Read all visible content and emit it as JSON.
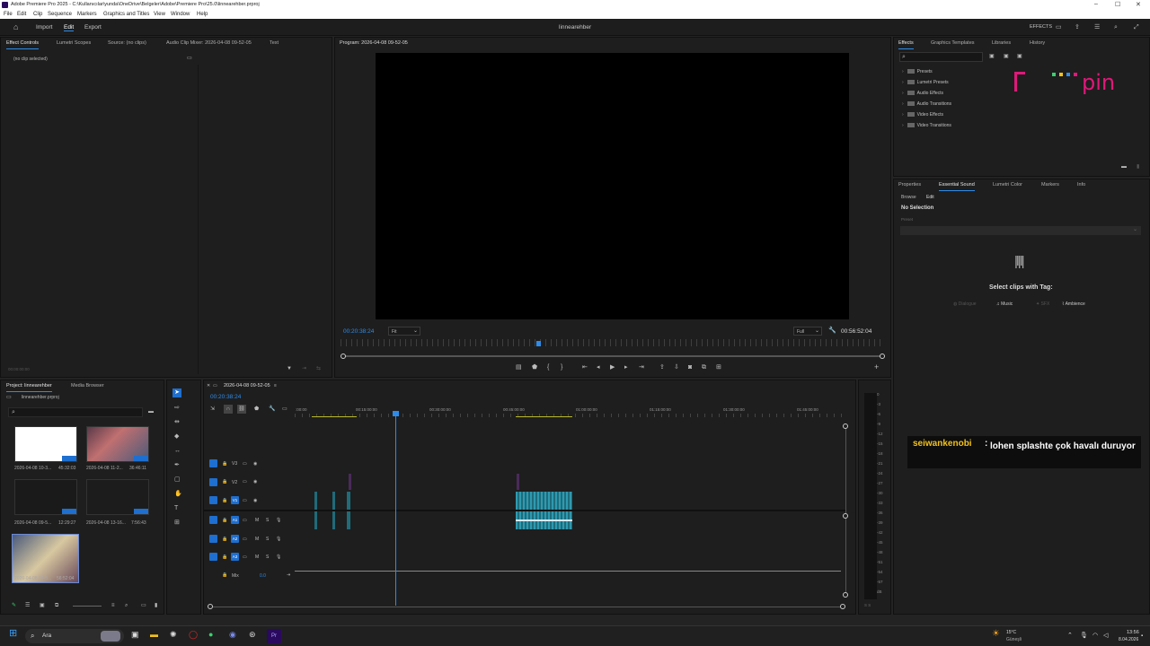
{
  "window": {
    "title": "Adobe Premiere Pro 2025 - C:\\Kullanıcılar\\yunda\\OneDrive\\Belgeler\\Adobe\\Premiere Pro\\25.0\\linnearehber.prproj"
  },
  "menu": [
    "File",
    "Edit",
    "Clip",
    "Sequence",
    "Markers",
    "Graphics and Titles",
    "View",
    "Window",
    "Help"
  ],
  "header": {
    "nav": [
      "Import",
      "Edit",
      "Export"
    ],
    "project_name": "linnearehber",
    "effects_label": "EFFECTS"
  },
  "source_panel": {
    "tabs": [
      "Effect Controls",
      "Lumetri Scopes",
      "Source: (no clips)",
      "Audio Clip Mixer: 2026-04-08 09-52-05",
      "Text"
    ],
    "no_clip": "(no clip selected)",
    "timecode": "00:00:00:00"
  },
  "program": {
    "title": "Program: 2026-04-08 09-52-05",
    "timecode_left": "00:20:38:24",
    "fit": "Fit",
    "quality": "Full",
    "timecode_right": "00:56:52:04",
    "playhead_fraction": 0.363
  },
  "effects_panel": {
    "tabs": [
      "Effects",
      "Graphics Templates",
      "Libraries",
      "History"
    ],
    "items": [
      "Presets",
      "Lumetri Presets",
      "Audio Effects",
      "Audio Transitions",
      "Video Effects",
      "Video Transitions"
    ],
    "logo_text": "pin"
  },
  "essential_sound": {
    "tabs": [
      "Properties",
      "Essential Sound",
      "Lumetri Color",
      "Markers",
      "Info"
    ],
    "subtabs": [
      "Browse",
      "Edit"
    ],
    "no_selection": "No Selection",
    "preset_label": "Preset",
    "select_text": "Select clips with Tag:",
    "tags": [
      "Dialogue",
      "Music",
      "SFX",
      "Ambience"
    ]
  },
  "chat": {
    "user": "seiwankenobi",
    "message": "lohen splashte çok havalı duruyor"
  },
  "project_panel": {
    "tabs": [
      "Project: linnearehber",
      "Media Browser"
    ],
    "file": "linnearehber.prproj",
    "items": [
      {
        "name": "2026-04-08 10-3...",
        "duration": "45:32:03"
      },
      {
        "name": "2026-04-08 11-2...",
        "duration": "36:46:11"
      },
      {
        "name": "2026-04-08 09-5...",
        "duration": "12:29:27"
      },
      {
        "name": "2026-04-08 13-16...",
        "duration": "7:56:43"
      },
      {
        "name": "2026-04-08 09-5...",
        "duration": "56:52:04"
      }
    ]
  },
  "timeline": {
    "sequence": "2026-04-08 09-52-05",
    "timecode": "00:20:38:24",
    "ruler": [
      ":00:00",
      "00:15:00:00",
      "00:30:00:00",
      "00:45:00:00",
      "01:00:00:00",
      "01:15:00:00",
      "01:30:00:00",
      "01:45:00:00"
    ],
    "video_tracks": [
      "V3",
      "V2",
      "V1"
    ],
    "audio_tracks": [
      "A1",
      "A2",
      "A3"
    ],
    "mix_label": "Mix",
    "mix_value": "0.0"
  },
  "meter": {
    "labels": [
      "0",
      "-3",
      "-6",
      "-9",
      "-12",
      "-15",
      "-18",
      "-21",
      "-24",
      "-27",
      "-30",
      "-33",
      "-36",
      "-39",
      "-42",
      "-45",
      "-48",
      "-51",
      "-54",
      "-57",
      "dB"
    ],
    "bottom": "S S"
  },
  "taskbar": {
    "search": "Ara",
    "weather_temp": "15°C",
    "weather_desc": "Güneşli",
    "time": "13:56",
    "date": "8.04.2026"
  }
}
